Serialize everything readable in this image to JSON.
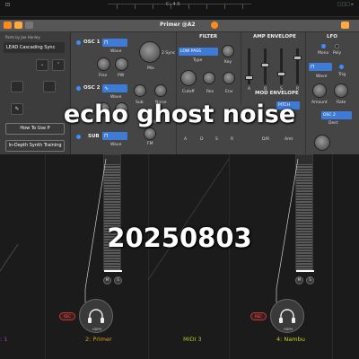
{
  "daw": {
    "left_label": "⊡",
    "center_label": "C♭ 4 II",
    "right_label": "□□□ ▸"
  },
  "synth": {
    "title": "Primer @A2",
    "parts_label": "Parts by Joe Hanley",
    "preset_name": "LEAD Cascading Sync",
    "buttons": {
      "how_to_use": "How To Use P",
      "training": "In-Depth Synth Training"
    },
    "osc1": {
      "title": "OSC 1",
      "wave_label": "Wave",
      "fine_label": "Fine",
      "pw_label": "PW"
    },
    "osc2": {
      "title": "OSC 2",
      "wave_label": "Wave"
    },
    "sub": {
      "title": "SUB",
      "wave_label": "Wave"
    },
    "mix": {
      "mix_label": "Mix",
      "sync_label": "2 Sync",
      "sub_label": "Sub",
      "noise_label": "Noise",
      "start_label": "Start",
      "fm_label": "FM"
    },
    "filter": {
      "title": "FILTER",
      "type_value": "LOW PASS",
      "type_label": "Type",
      "key_label": "Key",
      "cutoff_label": "Cutoff",
      "res_label": "Res",
      "env_label": "Env"
    },
    "amp_env": {
      "title": "AMP ENVELOPE",
      "letters": [
        "A",
        "D",
        "S",
        "R"
      ]
    },
    "mod_env": {
      "title": "MOD ENVELOPE",
      "dest_value": "PITCH",
      "letters": [
        "A",
        "D",
        "S",
        "R",
        "D/R",
        "Amt"
      ]
    },
    "lfo": {
      "title": "LFO",
      "mono_label": "Mono",
      "poly_label": "Poly",
      "wave_label": "Wave",
      "trig_label": "Trig",
      "amount_label": "Amount",
      "rate_label": "Rate",
      "dest_value": "OSC 2",
      "dest_label": "Dest"
    }
  },
  "mixer": {
    "tracks": [
      {
        "name": ": 1",
        "color": "#b43cb4"
      },
      {
        "name": "2: Primer",
        "color": "#d6a020"
      },
      {
        "name": "MIDI 3",
        "color": "#a8c020"
      },
      {
        "name": "4: Nambu",
        "color": "#c8d020"
      }
    ],
    "rec_label": "REC",
    "hp_label": "HDPH",
    "mute_label": "M",
    "solo_label": "S"
  },
  "overlay": {
    "title": "echo ghost noise",
    "date": "20250803"
  },
  "colors": {
    "accent": "#3e7bd6",
    "close": "#ff8c1a"
  }
}
